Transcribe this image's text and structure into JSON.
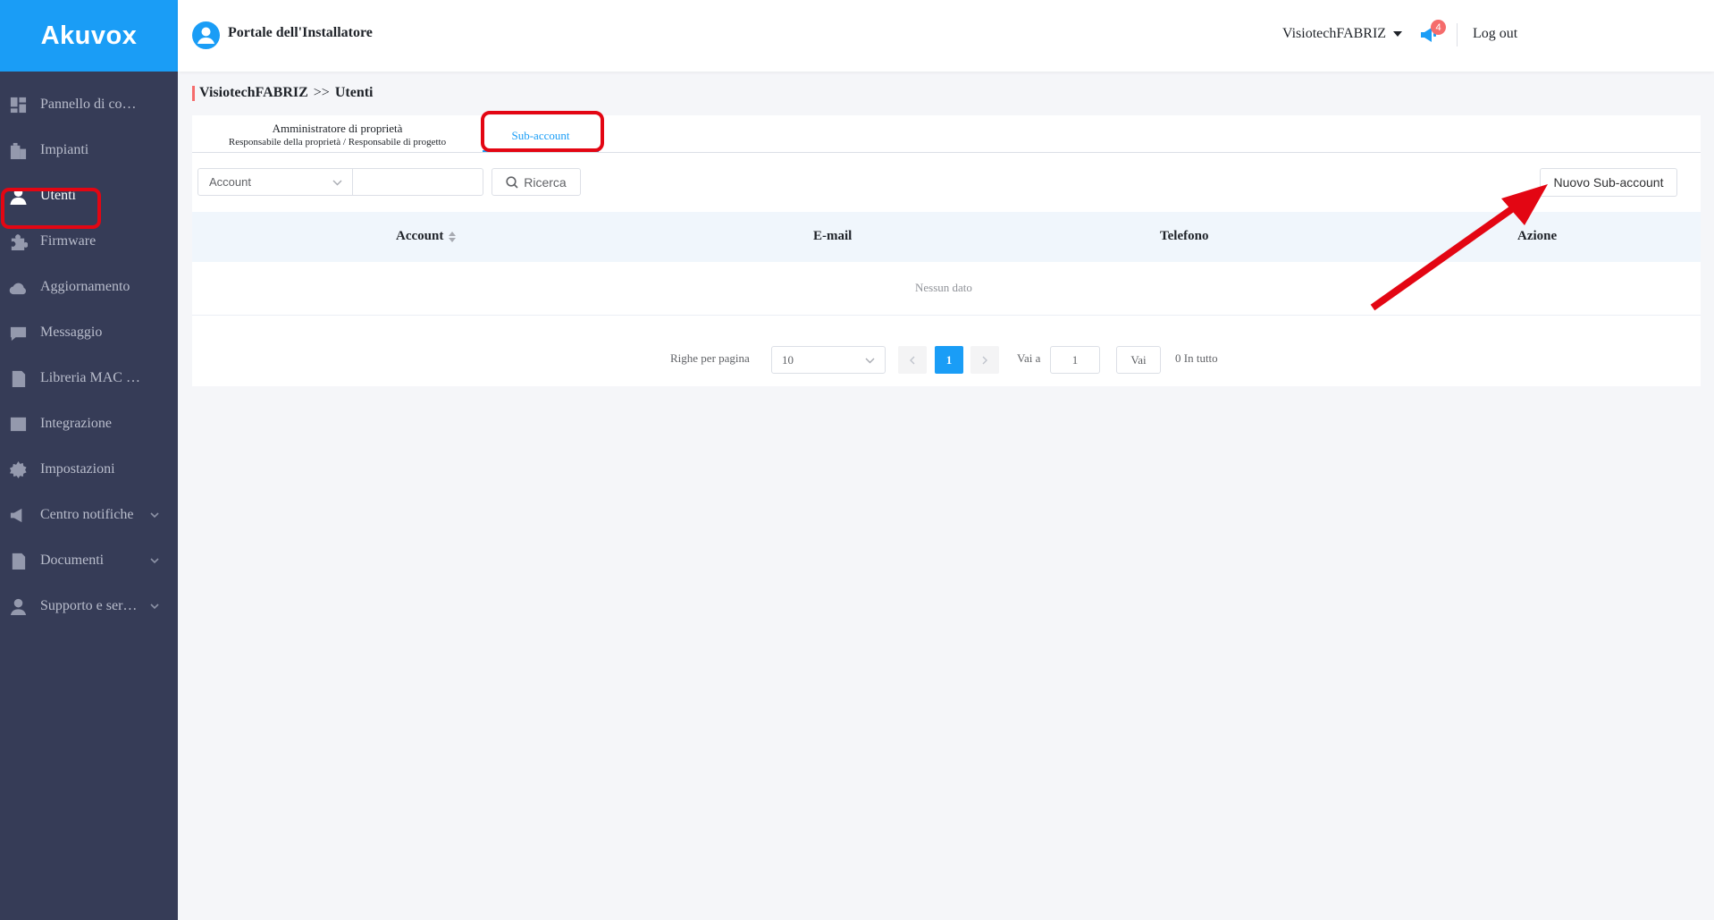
{
  "brand": {
    "logo_text": "Akuvox",
    "accent_color": "#1a9df6",
    "sidebar_color": "#363c57",
    "highlight_color": "#e30613"
  },
  "header": {
    "portal_title": "Portale dell'Installatore",
    "portal_icon": "user-circle-icon",
    "user_name": "VisiotechFABRIZ",
    "notification_count": "4",
    "notification_icon": "megaphone-icon",
    "logout_label": "Log out"
  },
  "sidebar": {
    "items": [
      {
        "label": "Pannello di co…",
        "icon": "dashboard-icon"
      },
      {
        "label": "Impianti",
        "icon": "building-icon"
      },
      {
        "label": "Utenti",
        "icon": "user-icon",
        "active": true
      },
      {
        "label": "Firmware",
        "icon": "puzzle-icon"
      },
      {
        "label": "Aggiornamento",
        "icon": "cloud-upload-icon"
      },
      {
        "label": "Messaggio",
        "icon": "chat-icon"
      },
      {
        "label": "Libreria MAC …",
        "icon": "document-icon"
      },
      {
        "label": "Integrazione",
        "icon": "list-icon"
      },
      {
        "label": "Impostazioni",
        "icon": "gear-icon"
      },
      {
        "label": "Centro notifiche",
        "icon": "megaphone-icon",
        "expandable": true
      },
      {
        "label": "Documenti",
        "icon": "document-icon",
        "expandable": true
      },
      {
        "label": "Supporto e ser…",
        "icon": "headset-icon",
        "expandable": true
      }
    ]
  },
  "breadcrumb": {
    "root": "VisiotechFABRIZ",
    "separator": ">>",
    "current": "Utenti"
  },
  "tabs": [
    {
      "label": "Amministratore di proprietà",
      "sublabel": "Responsabile della proprietà / Responsabile di progetto"
    },
    {
      "label": "Sub-account",
      "active": true
    }
  ],
  "filter": {
    "field_select": "Account",
    "search_value": "",
    "search_button": "Ricerca",
    "new_button": "Nuovo Sub-account"
  },
  "table": {
    "columns": [
      "Account",
      "E-mail",
      "Telefono",
      "Azione"
    ],
    "rows": [],
    "empty_text": "Nessun dato"
  },
  "pagination": {
    "rows_per_page_label": "Righe per pagina",
    "rows_per_page": "10",
    "current_page": "1",
    "goto_label": "Vai a",
    "goto_value": "1",
    "goto_button": "Vai",
    "total_text": "0 In tutto"
  }
}
